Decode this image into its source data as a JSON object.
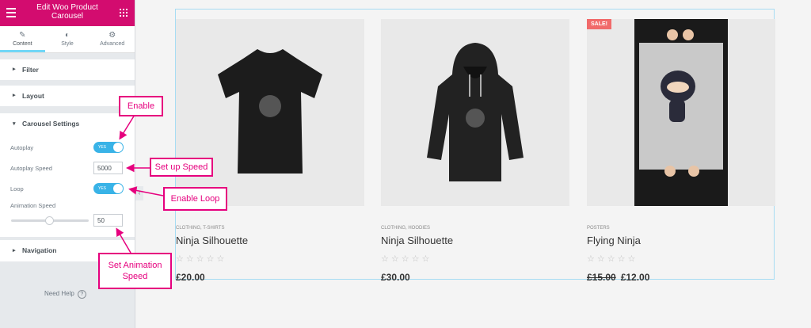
{
  "panel": {
    "title": "Edit Woo Product Carousel",
    "tabs": [
      {
        "label": "Content",
        "icon": "pencil-icon"
      },
      {
        "label": "Style",
        "icon": "contrast-icon"
      },
      {
        "label": "Advanced",
        "icon": "gear-icon"
      }
    ],
    "sections": {
      "filter": "Filter",
      "layout": "Layout",
      "carousel": "Carousel Settings",
      "navigation": "Navigation"
    },
    "controls": {
      "autoplay_label": "Autoplay",
      "autoplay_toggle": "YES",
      "autoplay_speed_label": "Autoplay Speed",
      "autoplay_speed_value": "5000",
      "loop_label": "Loop",
      "loop_toggle": "YES",
      "animation_speed_label": "Animation Speed",
      "animation_speed_value": "50"
    },
    "help": "Need Help",
    "help_icon": "?",
    "accent_color": "#d30c6f"
  },
  "products": [
    {
      "category": "CLOTHING, T-SHIRTS",
      "name": "Ninja Silhouette",
      "stars": "☆☆☆☆☆",
      "price": "£20.00",
      "old_price": ""
    },
    {
      "category": "CLOTHING, HOODIES",
      "name": "Ninja Silhouette",
      "stars": "☆☆☆☆☆",
      "price": "£30.00",
      "old_price": ""
    },
    {
      "category": "POSTERS",
      "name": "Flying Ninja",
      "stars": "☆☆☆☆☆",
      "price": "£12.00",
      "old_price": "£15.00",
      "badge": "SALE!"
    }
  ],
  "annotations": {
    "enable": "Enable",
    "speed": "Set up Speed",
    "loop": "Enable Loop",
    "anim_line1": "Set Animation",
    "anim_line2": "Speed",
    "color": "#e6007e"
  }
}
